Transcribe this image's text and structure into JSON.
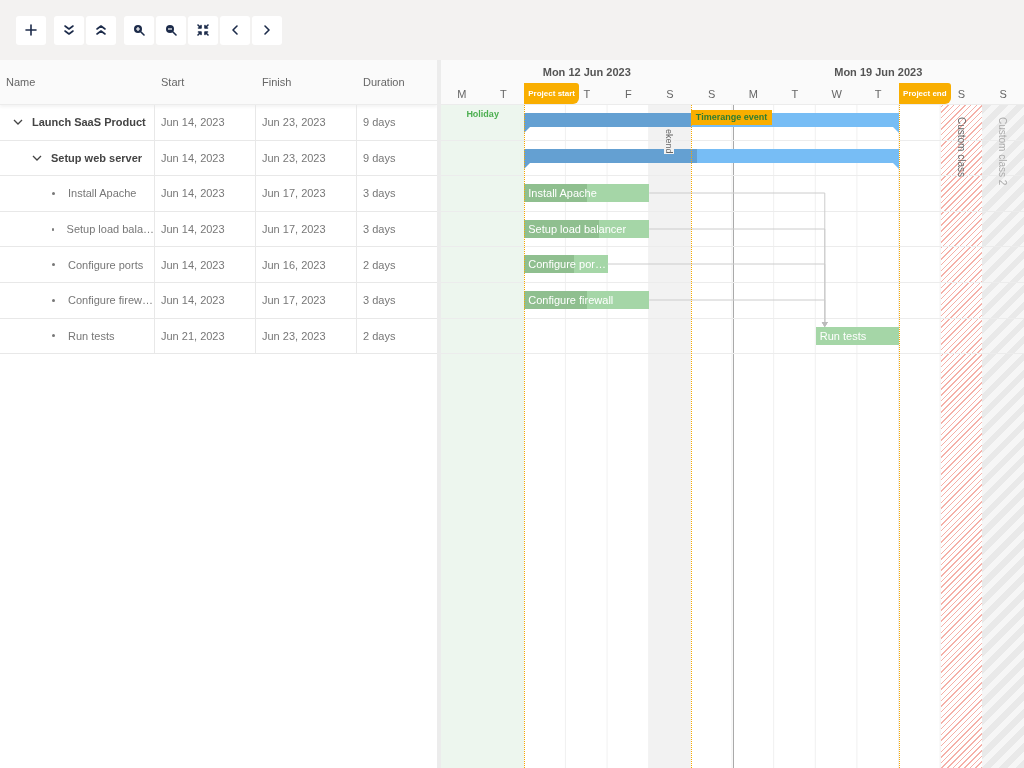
{
  "toolbar": {
    "groups": [
      [
        {
          "kind": "add"
        }
      ],
      [
        {
          "kind": "expand_all"
        },
        {
          "kind": "collapse_all"
        }
      ],
      [
        {
          "kind": "zoom_in"
        },
        {
          "kind": "zoom_out"
        },
        {
          "kind": "fit"
        },
        {
          "kind": "previous"
        },
        {
          "kind": "next"
        }
      ]
    ]
  },
  "grid": {
    "columns": [
      "Name",
      "Start",
      "Finish",
      "Duration"
    ]
  },
  "tasks": [
    {
      "name": "Launch SaaS Product",
      "start": "Jun 14, 2023",
      "finish": "Jun 23, 2023",
      "duration": "9 days",
      "expanded": true,
      "bar": {
        "kind": "summary",
        "level": 0.445
      },
      "children": [
        {
          "name": "Setup web server",
          "start": "Jun 14, 2023",
          "finish": "Jun 23, 2023",
          "duration": "9 days",
          "expanded": true,
          "bar": {
            "kind": "summary",
            "level": 0.46
          },
          "children": [
            {
              "name": "Install Apache",
              "start": "Jun 14, 2023",
              "finish": "Jun 17, 2023",
              "duration": "3 days",
              "bar": {
                "kind": "task",
                "level": 0.5,
                "label": "Install Apache"
              }
            },
            {
              "name": "Setup load bala…",
              "start": "Jun 14, 2023",
              "finish": "Jun 17, 2023",
              "duration": "3 days",
              "bar": {
                "kind": "task",
                "level": 0.6,
                "label": "Setup load balancer"
              }
            },
            {
              "name": "Configure ports",
              "start": "Jun 14, 2023",
              "finish": "Jun 16, 2023",
              "duration": "2 days",
              "bar": {
                "kind": "task",
                "level": 0.6,
                "label": "Configure por…"
              }
            },
            {
              "name": "Configure firew…",
              "start": "Jun 14, 2023",
              "finish": "Jun 17, 2023",
              "duration": "3 days",
              "bar": {
                "kind": "task",
                "level": 0.5,
                "label": "Configure firewall"
              }
            },
            {
              "name": "Run tests",
              "start": "Jun 21, 2023",
              "finish": "Jun 23, 2023",
              "duration": "2 days",
              "bar": {
                "kind": "task",
                "level": 0,
                "label": "Run tests"
              }
            }
          ]
        }
      ]
    }
  ],
  "timeline": {
    "weeks": [
      {
        "label": "Mon 12 Jun 2023"
      },
      {
        "label": "Mon 19 Jun 2023"
      }
    ],
    "days": [
      {
        "kind": "letter",
        "label": "M"
      },
      {
        "kind": "letter",
        "label": "T"
      },
      {
        "kind": "covered"
      },
      {
        "kind": "letter",
        "label": "T"
      },
      {
        "kind": "letter",
        "label": "F"
      },
      {
        "kind": "letter",
        "label": "S"
      },
      {
        "kind": "letter",
        "label": "S"
      },
      {
        "kind": "letter",
        "label": "M"
      },
      {
        "kind": "letter",
        "label": "T"
      },
      {
        "kind": "letter",
        "label": "W"
      },
      {
        "kind": "letter",
        "label": "T"
      },
      {
        "kind": "covered"
      },
      {
        "kind": "letter",
        "label": "S"
      },
      {
        "kind": "letter",
        "label": "S"
      }
    ],
    "ranges": [
      {
        "kind": "holiday",
        "label": "Holiday"
      },
      {
        "kind": "weekend",
        "label": "ekend"
      },
      {
        "kind": "custom",
        "label": "Custom class"
      },
      {
        "kind": "custom2",
        "label": "Custom class 2"
      }
    ],
    "markers": [
      {
        "kind": "project_start",
        "label": "Project start"
      },
      {
        "kind": "timerange",
        "label": "Timerange event"
      },
      {
        "kind": "today"
      },
      {
        "kind": "project_end",
        "label": "Project end"
      }
    ]
  }
}
